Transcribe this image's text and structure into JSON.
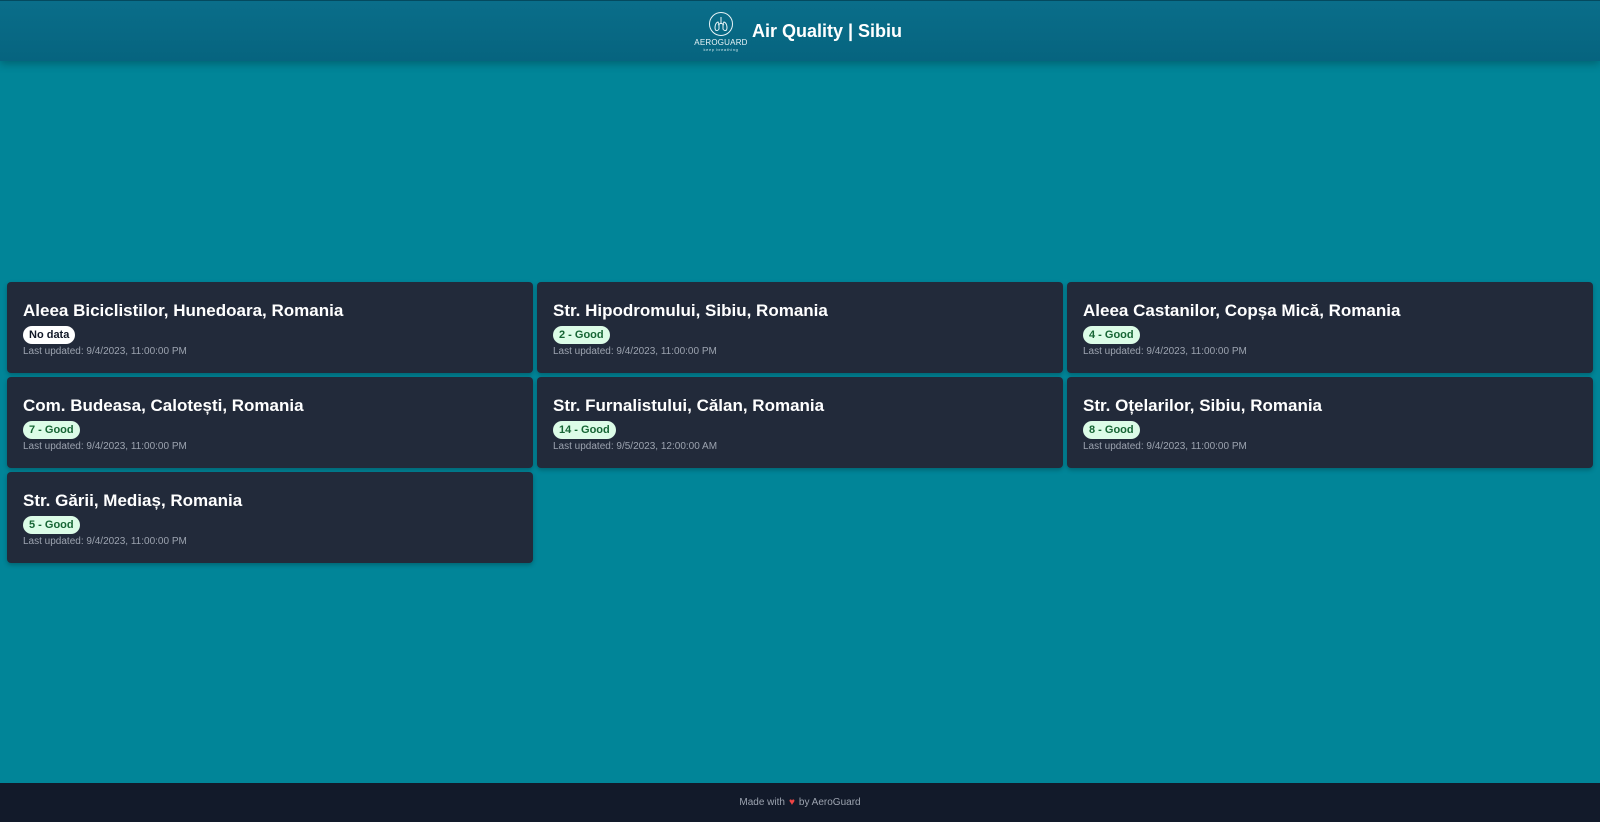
{
  "header": {
    "logo_text": "AEROGUARD",
    "logo_subtext": "keep breathing",
    "title": "Air Quality | Sibiu"
  },
  "colors": {
    "background": "#018598",
    "header": "#06647f",
    "card": "#222a3a",
    "footer": "#121a2a",
    "good_badge_bg": "#dcfce7",
    "good_badge_text": "#166534",
    "heart": "#ef4444"
  },
  "stations": [
    {
      "name": "Aleea Biciclistilor, Hunedoara, Romania",
      "status": "No data",
      "status_type": "nodata",
      "updated": "Last updated: 9/4/2023, 11:00:00 PM"
    },
    {
      "name": "Str. Hipodromului, Sibiu, Romania",
      "status": "2 - Good",
      "status_type": "good",
      "updated": "Last updated: 9/4/2023, 11:00:00 PM"
    },
    {
      "name": "Aleea Castanilor, Copșa Mică, Romania",
      "status": "4 - Good",
      "status_type": "good",
      "updated": "Last updated: 9/4/2023, 11:00:00 PM"
    },
    {
      "name": "Com. Budeasa, Calotești, Romania",
      "status": "7 - Good",
      "status_type": "good",
      "updated": "Last updated: 9/4/2023, 11:00:00 PM"
    },
    {
      "name": "Str. Furnalistului, Călan, Romania",
      "status": "14 - Good",
      "status_type": "good",
      "updated": "Last updated: 9/5/2023, 12:00:00 AM"
    },
    {
      "name": "Str. Oțelarilor, Sibiu, Romania",
      "status": "8 - Good",
      "status_type": "good",
      "updated": "Last updated: 9/4/2023, 11:00:00 PM"
    },
    {
      "name": "Str. Gării, Mediaș, Romania",
      "status": "5 - Good",
      "status_type": "good",
      "updated": "Last updated: 9/4/2023, 11:00:00 PM"
    }
  ],
  "footer": {
    "made_with": "Made with",
    "heart_icon": "heart-icon",
    "by": "by AeroGuard"
  }
}
